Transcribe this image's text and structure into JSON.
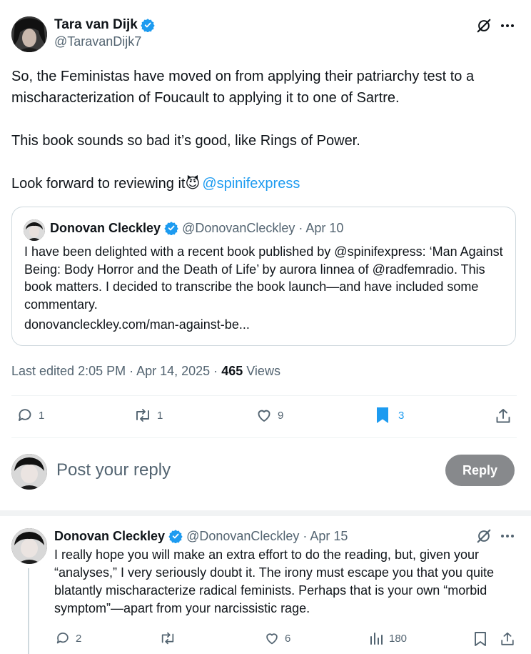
{
  "main_post": {
    "author_name": "Tara van Dijk",
    "author_handle": "@TaravanDijk7",
    "paragraphs": [
      "So, the Feministas have moved on from applying their patriarchy test to a mischaracterization of Foucault to applying it to one of Sartre.",
      "This book sounds so bad it’s good, like Rings of Power."
    ],
    "last_line_text": "Look forward to reviewing it",
    "emoji": "😈",
    "mention": "@spinifexpress",
    "quote": {
      "author_name": "Donovan Cleckley",
      "author_handle": "@DonovanCleckley",
      "date": "· Apr 10",
      "text": "I have been delighted with a recent book published by @spinifexpress: ‘Man Against Being: Body Horror and the Death of Life’ by aurora linnea of @radfemradio. This book matters. I decided to transcribe the book launch—and have included some commentary.",
      "link": "donovancleckley.com/man-against-be..."
    },
    "meta_prefix": "Last edited 2:05 PM · Apr 14, 2025 · ",
    "views_count": "465",
    "views_label": "Views",
    "stats": {
      "replies": "1",
      "reposts": "1",
      "likes": "9",
      "bookmarks": "3"
    }
  },
  "reply_composer": {
    "placeholder": "Post your reply",
    "button_label": "Reply"
  },
  "reply_post": {
    "author_name": "Donovan Cleckley",
    "author_handle": "@DonovanCleckley",
    "date": "· Apr 15",
    "text": "I really hope you will make an extra effort to do the reading, but, given your “analyses,” I very seriously doubt it. The irony must escape you that you quite blatantly mischaracterize radical feminists. Perhaps that is your own “morbid symptom”—apart from your narcissistic rage.",
    "stats": {
      "replies": "2",
      "likes": "6",
      "views": "180"
    }
  },
  "colors": {
    "accent": "#1d9bf0",
    "text": "#0f1419",
    "muted": "#536471",
    "border": "#cfd9de",
    "reply_button": "#87898c"
  },
  "icons": [
    "verified-badge-icon",
    "grok-icon",
    "more-icon",
    "reply-icon",
    "repost-icon",
    "like-icon",
    "bookmark-icon",
    "share-icon",
    "views-icon"
  ]
}
